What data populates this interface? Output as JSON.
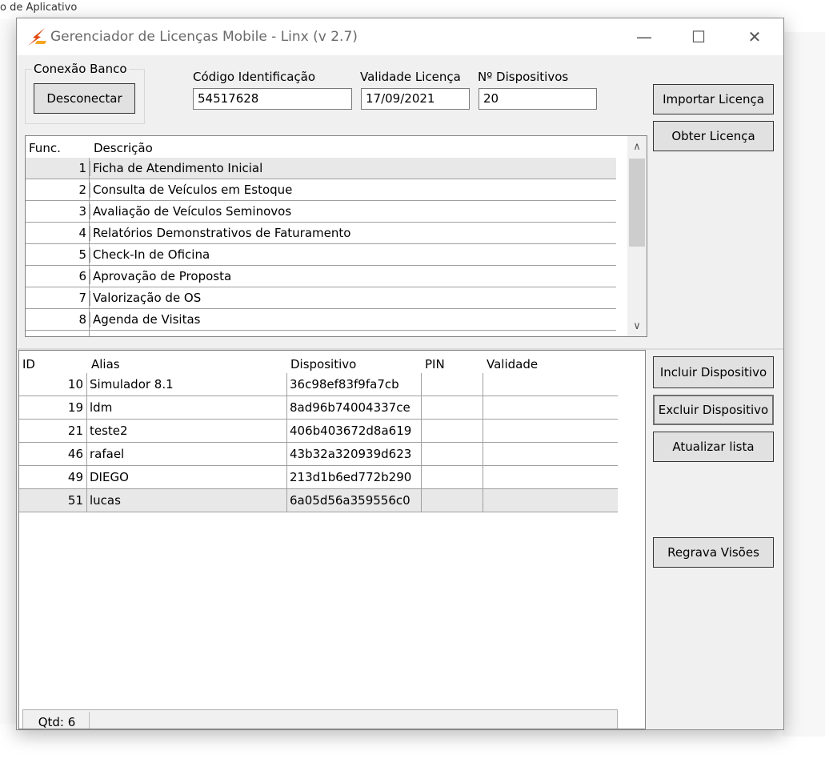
{
  "window": {
    "title": "Gerenciador de Licenças Mobile - Linx (v 2.7)",
    "controls": {
      "minimize": "—",
      "maximize": "☐",
      "close": "✕"
    }
  },
  "background": {
    "top_fragment": "o de Aplicativo"
  },
  "connection": {
    "group_label": "Conexão Banco",
    "disconnect_button": "Desconectar"
  },
  "license": {
    "code_label": "Código Identificação",
    "code_value": "54517628",
    "validity_label": "Validade Licença",
    "validity_value": "17/09/2021",
    "devices_label": "Nº Dispositivos",
    "devices_value": "20"
  },
  "top_buttons": {
    "import": "Importar Licença",
    "obtain": "Obter Licença"
  },
  "functions": {
    "headers": {
      "func": "Func.",
      "desc": "Descrição"
    },
    "rows": [
      {
        "num": "1",
        "desc": "Ficha de Atendimento Inicial"
      },
      {
        "num": "2",
        "desc": "Consulta de Veículos em Estoque"
      },
      {
        "num": "3",
        "desc": "Avaliação de Veículos Seminovos"
      },
      {
        "num": "4",
        "desc": "Relatórios Demonstrativos de Faturamento"
      },
      {
        "num": "5",
        "desc": "Check-In de Oficina"
      },
      {
        "num": "6",
        "desc": "Aprovação de Proposta"
      },
      {
        "num": "7",
        "desc": "Valorização de OS"
      },
      {
        "num": "8",
        "desc": "Agenda de Visitas"
      }
    ]
  },
  "devices": {
    "headers": {
      "id": "ID",
      "alias": "Alias",
      "device": "Dispositivo",
      "pin": "PIN",
      "validity": "Validade"
    },
    "rows": [
      {
        "id": "10",
        "alias": "Simulador 8.1",
        "device": "36c98ef83f9fa7cb",
        "pin": "",
        "validity": ""
      },
      {
        "id": "19",
        "alias": "ldm",
        "device": "8ad96b74004337ce",
        "pin": "",
        "validity": ""
      },
      {
        "id": "21",
        "alias": "teste2",
        "device": "406b403672d8a619",
        "pin": "",
        "validity": ""
      },
      {
        "id": "46",
        "alias": "rafael",
        "device": "43b32a320939d623",
        "pin": "",
        "validity": ""
      },
      {
        "id": "49",
        "alias": "DIEGO",
        "device": "213d1b6ed772b290",
        "pin": "",
        "validity": ""
      },
      {
        "id": "51",
        "alias": "lucas",
        "device": "6a05d56a359556c0",
        "pin": "",
        "validity": ""
      }
    ],
    "count": "Qtd: 6"
  },
  "device_buttons": {
    "include": "Incluir Dispositivo",
    "exclude": "Excluir Dispositivo",
    "refresh": "Atualizar lista",
    "rewrite": "Regrava Visões"
  },
  "colors": {
    "accent_icon": "#e04a12",
    "window_bg": "#f0f0f0",
    "button_bg": "#e1e1e1"
  }
}
